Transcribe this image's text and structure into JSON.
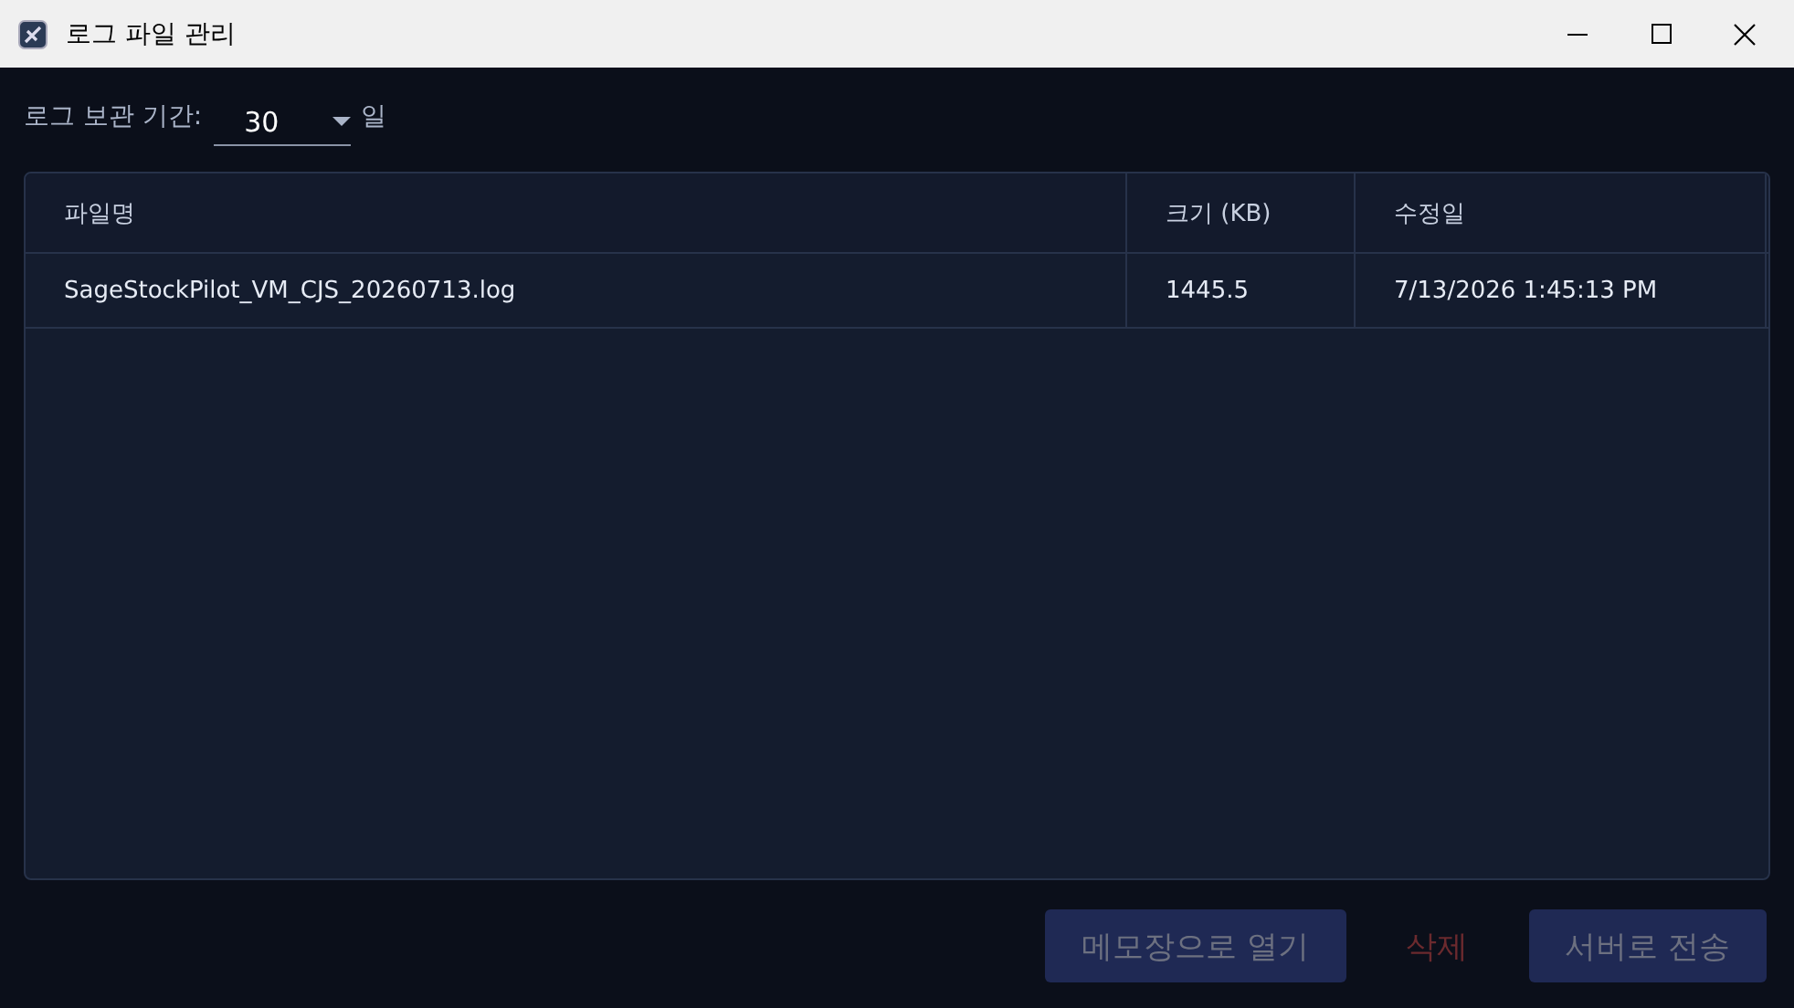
{
  "window": {
    "title": "로그 파일 관리"
  },
  "retention": {
    "label": "로그 보관 기간:",
    "value": "30",
    "unit": "일"
  },
  "table": {
    "columns": [
      "파일명",
      "크기 (KB)",
      "수정일"
    ],
    "rows": [
      {
        "cells": [
          "SageStockPilot_VM_CJS_20260713.log",
          "1445.5",
          "7/13/2026 1:45:13 PM"
        ]
      }
    ]
  },
  "buttons": [
    {
      "label": "메모장으로 열기",
      "kind": "filled",
      "disabled": true
    },
    {
      "label": "삭제",
      "kind": "text",
      "disabled": true
    },
    {
      "label": "서버로 전송",
      "kind": "filled",
      "disabled": true
    }
  ]
}
